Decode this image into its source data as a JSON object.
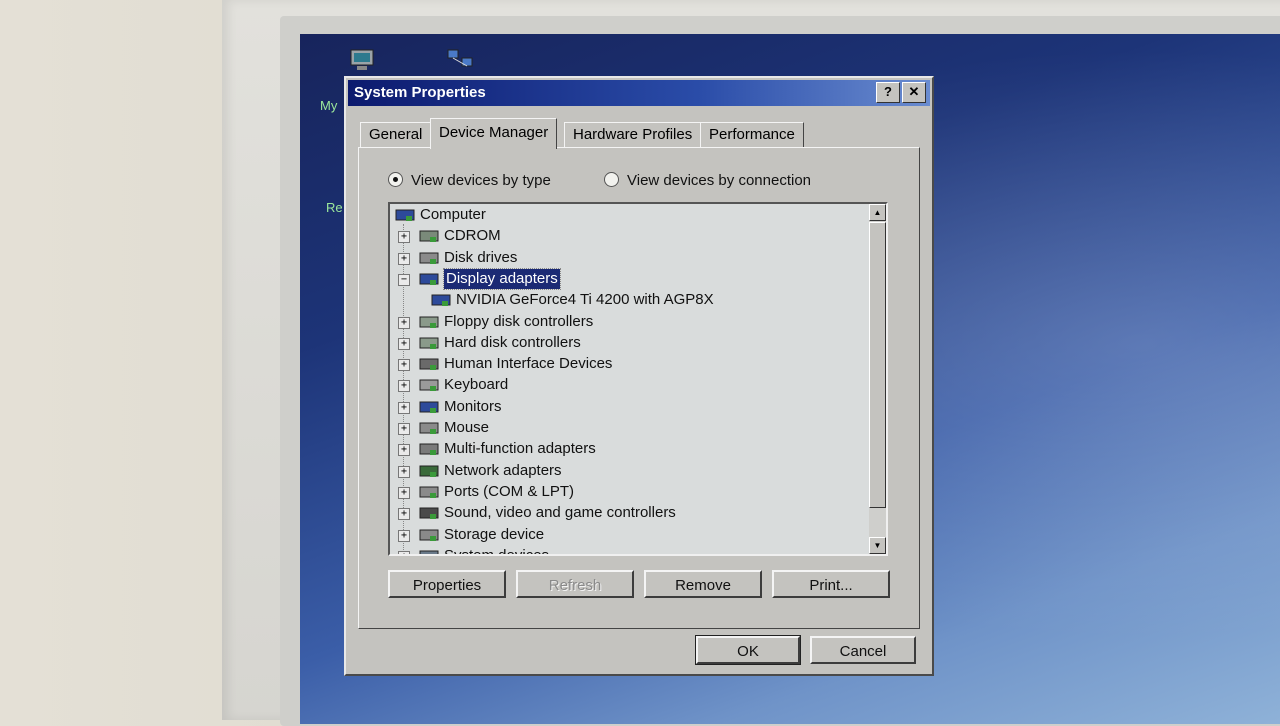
{
  "desktop": {
    "icons": [
      {
        "label": "My",
        "icon": "computer-icon"
      },
      {
        "label": "Re",
        "icon": "recycle-bin-icon"
      }
    ],
    "network_icon": "network-icon"
  },
  "window": {
    "title": "System Properties",
    "help_glyph": "?",
    "close_glyph": "✕"
  },
  "tabs": [
    "General",
    "Device Manager",
    "Hardware Profiles",
    "Performance"
  ],
  "active_tab": "Device Manager",
  "view": {
    "by_type": "View devices by type",
    "by_connection": "View devices by connection",
    "selected": "View devices by type"
  },
  "device_tree": {
    "root": "Computer",
    "items": [
      {
        "label": "CDROM",
        "icon": "cdrom-icon",
        "expander": "+"
      },
      {
        "label": "Disk drives",
        "icon": "disk-drive-icon",
        "expander": "+"
      },
      {
        "label": "Display adapters",
        "icon": "display-adapter-icon",
        "expander": "−",
        "selected": true
      },
      {
        "label": "NVIDIA GeForce4 Ti 4200 with AGP8X",
        "icon": "display-adapter-icon",
        "child": true
      },
      {
        "label": "Floppy disk controllers",
        "icon": "floppy-controller-icon",
        "expander": "+"
      },
      {
        "label": "Hard disk controllers",
        "icon": "hard-disk-controller-icon",
        "expander": "+"
      },
      {
        "label": "Human Interface Devices",
        "icon": "hid-icon",
        "expander": "+"
      },
      {
        "label": "Keyboard",
        "icon": "keyboard-icon",
        "expander": "+"
      },
      {
        "label": "Monitors",
        "icon": "monitor-icon",
        "expander": "+"
      },
      {
        "label": "Mouse",
        "icon": "mouse-icon",
        "expander": "+"
      },
      {
        "label": "Multi-function adapters",
        "icon": "multifunction-icon",
        "expander": "+"
      },
      {
        "label": "Network adapters",
        "icon": "network-adapter-icon",
        "expander": "+"
      },
      {
        "label": "Ports (COM & LPT)",
        "icon": "port-icon",
        "expander": "+"
      },
      {
        "label": "Sound, video and game controllers",
        "icon": "sound-icon",
        "expander": "+"
      },
      {
        "label": "Storage device",
        "icon": "storage-icon",
        "expander": "+"
      },
      {
        "label": "System devices",
        "icon": "system-device-icon",
        "expander": "+"
      }
    ]
  },
  "buttons": {
    "properties": "Properties",
    "refresh": "Refresh",
    "remove": "Remove",
    "print": "Print...",
    "ok": "OK",
    "cancel": "Cancel"
  },
  "colors": {
    "title_bar": "#0c1a6e",
    "selection": "#1b2a74",
    "window_face": "#c4c3bf"
  }
}
